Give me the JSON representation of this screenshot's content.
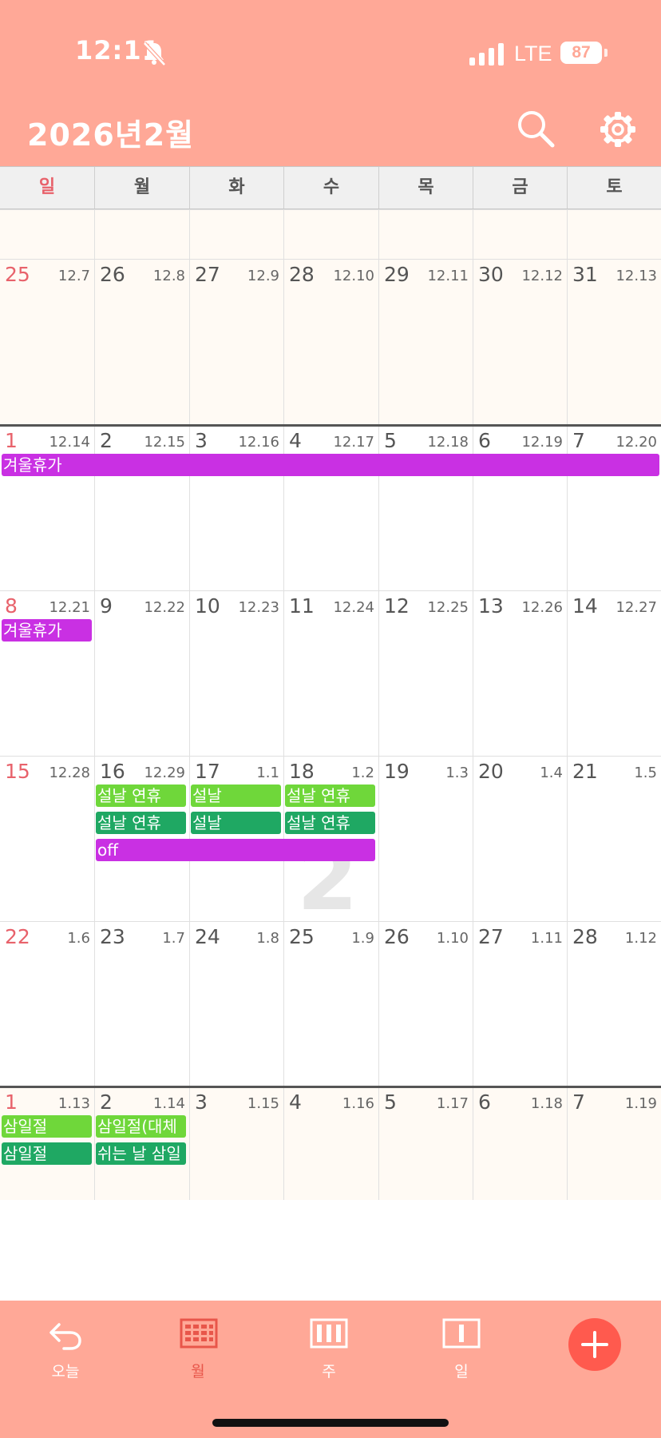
{
  "status_bar": {
    "time": "12:11",
    "network": "LTE",
    "battery": "87"
  },
  "header": {
    "title": "2026년2월"
  },
  "weekdays": [
    "일",
    "월",
    "화",
    "수",
    "목",
    "금",
    "토"
  ],
  "weeks": [
    {
      "days": [
        {
          "d": "25",
          "l": "12.7"
        },
        {
          "d": "26",
          "l": "12.8"
        },
        {
          "d": "27",
          "l": "12.9"
        },
        {
          "d": "28",
          "l": "12.10"
        },
        {
          "d": "29",
          "l": "12.11"
        },
        {
          "d": "30",
          "l": "12.12"
        },
        {
          "d": "31",
          "l": "12.13"
        }
      ]
    },
    {
      "days": [
        {
          "d": "1",
          "l": "12.14"
        },
        {
          "d": "2",
          "l": "12.15"
        },
        {
          "d": "3",
          "l": "12.16"
        },
        {
          "d": "4",
          "l": "12.17"
        },
        {
          "d": "5",
          "l": "12.18"
        },
        {
          "d": "6",
          "l": "12.19"
        },
        {
          "d": "7",
          "l": "12.20"
        }
      ]
    },
    {
      "days": [
        {
          "d": "8",
          "l": "12.21"
        },
        {
          "d": "9",
          "l": "12.22"
        },
        {
          "d": "10",
          "l": "12.23"
        },
        {
          "d": "11",
          "l": "12.24"
        },
        {
          "d": "12",
          "l": "12.25"
        },
        {
          "d": "13",
          "l": "12.26"
        },
        {
          "d": "14",
          "l": "12.27"
        }
      ]
    },
    {
      "days": [
        {
          "d": "15",
          "l": "12.28"
        },
        {
          "d": "16",
          "l": "12.29"
        },
        {
          "d": "17",
          "l": "1.1"
        },
        {
          "d": "18",
          "l": "1.2"
        },
        {
          "d": "19",
          "l": "1.3"
        },
        {
          "d": "20",
          "l": "1.4"
        },
        {
          "d": "21",
          "l": "1.5"
        }
      ]
    },
    {
      "days": [
        {
          "d": "22",
          "l": "1.6"
        },
        {
          "d": "23",
          "l": "1.7"
        },
        {
          "d": "24",
          "l": "1.8"
        },
        {
          "d": "25",
          "l": "1.9"
        },
        {
          "d": "26",
          "l": "1.10"
        },
        {
          "d": "27",
          "l": "1.11"
        },
        {
          "d": "28",
          "l": "1.12"
        }
      ]
    },
    {
      "days": [
        {
          "d": "1",
          "l": "1.13"
        },
        {
          "d": "2",
          "l": "1.14"
        },
        {
          "d": "3",
          "l": "1.15"
        },
        {
          "d": "4",
          "l": "1.16"
        },
        {
          "d": "5",
          "l": "1.17"
        },
        {
          "d": "6",
          "l": "1.18"
        },
        {
          "d": "7",
          "l": "1.19"
        }
      ]
    }
  ],
  "events": {
    "winter1": "겨울휴가",
    "winter2": "겨울휴가",
    "seollal_holiday": "설날 연휴",
    "seollal": "설날",
    "off": "off",
    "samiljeol": "삼일절",
    "samiljeol_sub": "삼일절(대체",
    "rest_day": "쉬는 날 삼일"
  },
  "watermark": "2",
  "colors": {
    "primary": "#FFA897",
    "sunday": "#E8626B",
    "purple": "#C930E3",
    "light_green": "#6FD73A",
    "dark_green": "#1FA863",
    "add": "#FF5A4E"
  },
  "bottom_nav": {
    "today": "오늘",
    "month": "월",
    "week": "주",
    "day": "일"
  }
}
